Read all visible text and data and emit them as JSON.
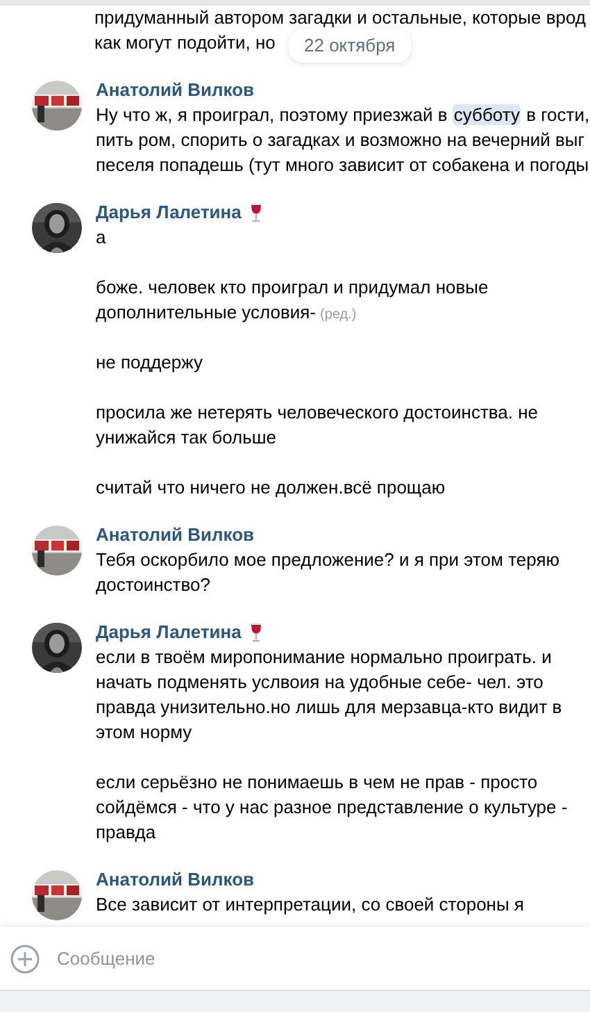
{
  "top_fragment": {
    "lines": [
      "придуманный автором загадки и остальные, которые врод",
      "как могут подойти, но"
    ]
  },
  "date_pill": "22 октября",
  "messages": [
    {
      "author": "Анатолий Вилков",
      "status_icon": false,
      "paragraphs": [
        {
          "lines": [
            [
              {
                "text": "Ну что ж, я проиграл, поэтому приезжай в ",
                "highlighted": false
              },
              {
                "text": "субботу",
                "highlighted": true
              },
              {
                "text": " в гости,",
                "highlighted": false
              }
            ],
            [
              {
                "text": "пить ром, спорить о загадках и возможно на вечерний выг",
                "highlighted": false
              }
            ],
            [
              {
                "text": "песеля попадешь (тут много зависит от собакена и погоды",
                "highlighted": false
              }
            ]
          ]
        }
      ]
    },
    {
      "author": "Дарья Лалетина",
      "status_icon": true,
      "paragraphs": [
        {
          "lines": [
            [
              {
                "text": "а",
                "highlighted": false
              }
            ]
          ]
        },
        {
          "lines": [
            [
              {
                "text": "боже. человек кто проиграл и придумал новые",
                "highlighted": false
              }
            ],
            [
              {
                "text": "дополнительные условия-",
                "highlighted": false
              }
            ]
          ],
          "edited_mark": "(ред.)"
        },
        {
          "lines": [
            [
              {
                "text": "не поддержу",
                "highlighted": false
              }
            ]
          ]
        },
        {
          "lines": [
            [
              {
                "text": "просила же нетерять человеческого достоинства. не",
                "highlighted": false
              }
            ],
            [
              {
                "text": "унижайся так больше",
                "highlighted": false
              }
            ]
          ]
        },
        {
          "lines": [
            [
              {
                "text": "считай что ничего не должен.всё прощаю",
                "highlighted": false
              }
            ]
          ]
        }
      ]
    },
    {
      "author": "Анатолий Вилков",
      "status_icon": false,
      "paragraphs": [
        {
          "lines": [
            [
              {
                "text": "Тебя оскорбило мое предложение? и я при этом теряю",
                "highlighted": false
              }
            ],
            [
              {
                "text": "достоинство?",
                "highlighted": false
              }
            ]
          ]
        }
      ]
    },
    {
      "author": "Дарья Лалетина",
      "status_icon": true,
      "paragraphs": [
        {
          "lines": [
            [
              {
                "text": "если в твоём миропонимание нормально проиграть. и",
                "highlighted": false
              }
            ],
            [
              {
                "text": "начать подменять услвоия на удобные себе- чел. это",
                "highlighted": false
              }
            ],
            [
              {
                "text": "правда унизительно.но лишь для мерзавца-кто видит в",
                "highlighted": false
              }
            ],
            [
              {
                "text": "этом норму",
                "highlighted": false
              }
            ]
          ]
        },
        {
          "lines": [
            [
              {
                "text": "если серьёзно не понимаешь в чем не прав - просто",
                "highlighted": false
              }
            ],
            [
              {
                "text": "сойдёмся  - что у нас разное представление о культуре -",
                "highlighted": false
              }
            ],
            [
              {
                "text": "правда",
                "highlighted": false
              }
            ]
          ]
        }
      ]
    },
    {
      "author": "Анатолий Вилков",
      "status_icon": false,
      "paragraphs": [
        {
          "lines": [
            [
              {
                "text": "Все зависит от интерпретации, со своей стороны я",
                "highlighted": false
              }
            ]
          ]
        }
      ]
    }
  ],
  "composer": {
    "placeholder": "Сообщение"
  }
}
